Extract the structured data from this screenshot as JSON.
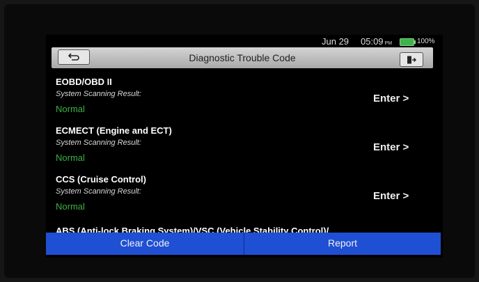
{
  "status": {
    "date": "Jun 29",
    "time": "05:09",
    "ampm": "PM",
    "battery": "100%",
    "battery_level": 1.0
  },
  "header": {
    "title": "Diagnostic Trouble Code",
    "back_icon": "back-arrow-icon",
    "exit_icon": "exit-icon"
  },
  "systems": [
    {
      "name": "EOBD/OBD II",
      "result_label": "System Scanning Result:",
      "result": "Normal",
      "action": "Enter >"
    },
    {
      "name": "ECMECT (Engine and ECT)",
      "result_label": "System Scanning Result:",
      "result": "Normal",
      "action": "Enter >"
    },
    {
      "name": "CCS (Cruise Control)",
      "result_label": "System Scanning Result:",
      "result": "Normal",
      "action": "Enter >"
    },
    {
      "name": "ABS (Anti-lock Braking System)/VSC (Vehicle Stability Control)/"
    }
  ],
  "footer": {
    "clear_label": "Clear Code",
    "report_label": "Report"
  },
  "colors": {
    "status_normal": "#3cb043",
    "footer_bar": "#1f4fd3"
  }
}
